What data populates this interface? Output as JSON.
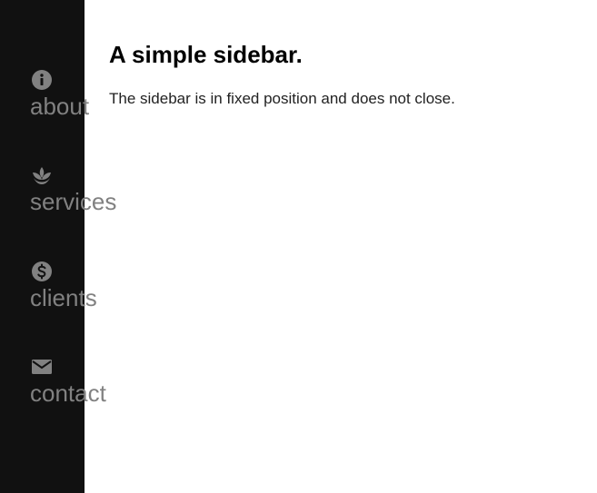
{
  "sidebar": {
    "background": "#111111",
    "link_color": "#818181",
    "items": [
      {
        "label": "about",
        "icon": "info-icon"
      },
      {
        "label": "services",
        "icon": "spa-icon"
      },
      {
        "label": "clients",
        "icon": "dollar-icon"
      },
      {
        "label": "contact",
        "icon": "envelope-icon"
      }
    ]
  },
  "main": {
    "title": "A simple sidebar.",
    "text": "The sidebar is in fixed position and does not close."
  }
}
